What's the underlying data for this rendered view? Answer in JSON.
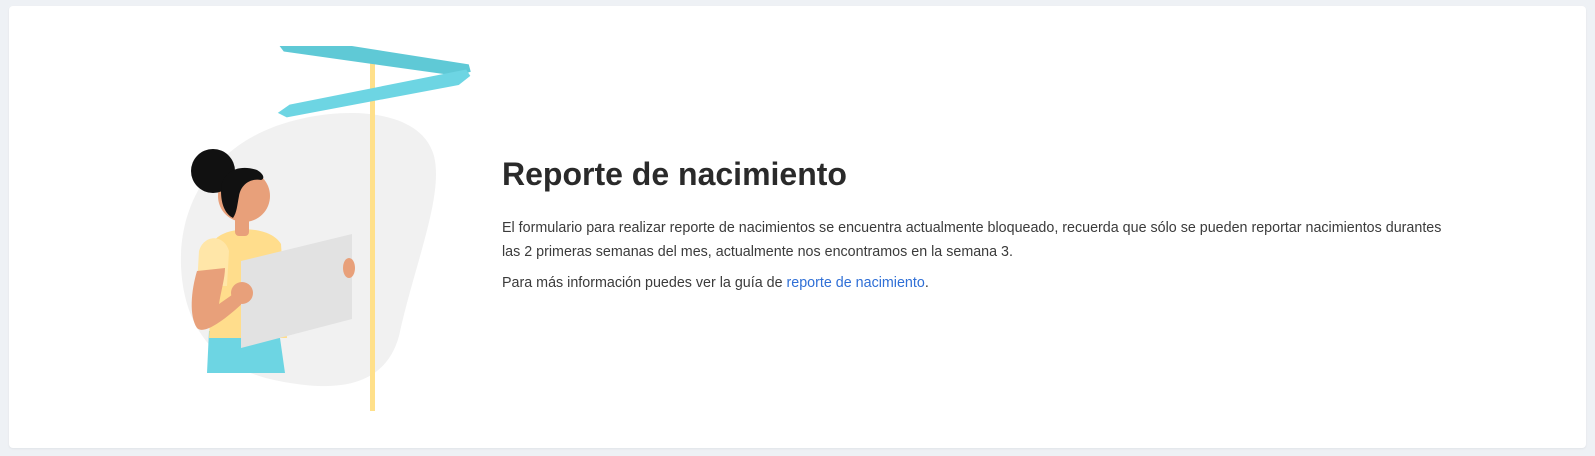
{
  "notice": {
    "title": "Reporte de nacimiento",
    "description": "El formulario para realizar reporte de nacimientos se encuentra actualmente bloqueado, recuerda que sólo se pueden reportar nacimientos durantes las 2 primeras semanas del mes, actualmente nos encontramos en la semana 3.",
    "info_prefix": "Para más información puedes ver la guía de ",
    "info_link": "reporte de nacimiento",
    "info_suffix": "."
  },
  "colors": {
    "sign": "#5fcfdc",
    "pole": "#ffe08a",
    "blob": "#f1f1f1",
    "skin": "#e8a07a",
    "shirt": "#ffdd8c",
    "skirt": "#6dd5e3",
    "hair": "#111111",
    "map": "#e2e2e2",
    "link": "#2f6fd6"
  },
  "illustration": {
    "name": "woman-with-map-signpost-illustration"
  }
}
